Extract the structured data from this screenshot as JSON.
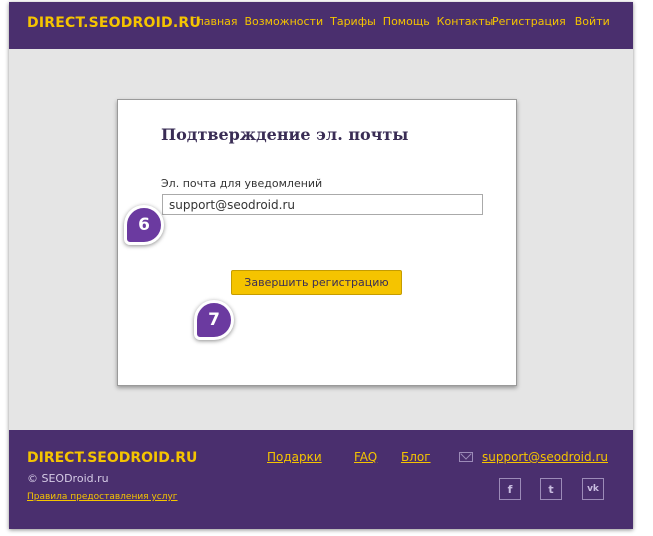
{
  "header": {
    "logo": "DIRECT.SEODROID.RU",
    "nav": [
      "Главная",
      "Возможности",
      "Тарифы",
      "Помощь",
      "Контакты"
    ],
    "nav_right": [
      "Регистрация",
      "Войти"
    ]
  },
  "card": {
    "title": "Подтверждение эл. почты",
    "email_label": "Эл. почта для уведомлений",
    "email_value": "support@seodroid.ru",
    "submit_label": "Завершить регистрацию"
  },
  "steps": [
    "6",
    "7"
  ],
  "footer": {
    "logo": "DIRECT.SEODROID.RU",
    "copyright": "© SEODroid.ru",
    "terms": "Правила предоставления услуг",
    "links": [
      "Подарки",
      "FAQ",
      "Блог"
    ],
    "email": "support@seodroid.ru",
    "social": [
      {
        "icon": "facebook-icon",
        "glyph": "f"
      },
      {
        "icon": "twitter-icon",
        "glyph": "t"
      },
      {
        "icon": "vk-icon",
        "glyph": "vk"
      }
    ]
  },
  "colors": {
    "brand_purple": "#4a2f6e",
    "accent_yellow": "#f5c400",
    "badge_purple": "#6b3aa0"
  }
}
